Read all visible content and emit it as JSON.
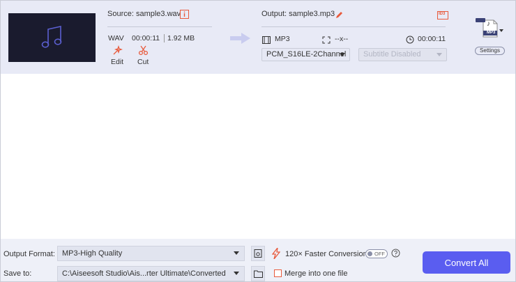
{
  "item": {
    "source_label": "Source: sample3.wav",
    "format": "WAV",
    "duration": "00:00:11",
    "size": "1.92 MB",
    "edit_label": "Edit",
    "cut_label": "Cut",
    "output_label": "Output: sample3.mp3",
    "output_format": "MP3",
    "resolution": "--x--",
    "output_duration": "00:00:11",
    "audio_track": "PCM_S16LE-2Channel",
    "subtitle": "Subtitle Disabled",
    "settings_label": "Settings",
    "format_badge": "MP3",
    "id3_badge": "ID3"
  },
  "bottom": {
    "output_format_label": "Output Format:",
    "output_format_value": "MP3-High Quality",
    "save_to_label": "Save to:",
    "save_to_value": "C:\\Aiseesoft Studio\\Ais...rter Ultimate\\Converted",
    "faster_label": "120× Faster Conversion",
    "toggle_label": "OFF",
    "merge_label": "Merge into one file",
    "convert_label": "Convert All"
  },
  "colors": {
    "accent": "#5a5df0",
    "orange": "#e85a3c",
    "row_bg": "#e8eaf6"
  }
}
